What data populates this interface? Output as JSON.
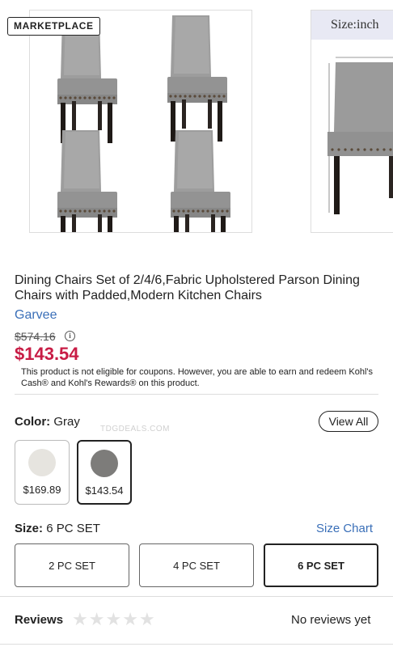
{
  "gallery": {
    "badge": "MARKETPLACE",
    "next_slide_title": "Size:inch",
    "slide_count": 5,
    "active_slide": 1
  },
  "product": {
    "title": "Dining Chairs Set of 2/4/6,Fabric Upholstered Parson Dining Chairs with Padded,Modern Kitchen Chairs",
    "brand": "Garvee",
    "original_price": "$574.16",
    "sale_price": "$143.54",
    "coupon_note": "This product is not eligible for coupons. However, you are able to earn and redeem Kohl's Cash® and Kohl's Rewards® on this product."
  },
  "color": {
    "label": "Color:",
    "value": "Gray",
    "view_all": "View All",
    "watermark": "TDGDEALS.COM",
    "swatches": [
      {
        "price": "$169.89",
        "color": "#e6e4df",
        "selected": false
      },
      {
        "price": "$143.54",
        "color": "#7d7c7a",
        "selected": true
      }
    ]
  },
  "size": {
    "label": "Size:",
    "value": "6 PC SET",
    "chart_link": "Size Chart",
    "options": [
      "2 PC SET",
      "4 PC SET",
      "6 PC SET"
    ],
    "selected": "6 PC SET"
  },
  "reviews": {
    "label": "Reviews",
    "rating": 0,
    "max_rating": 5,
    "status": "No reviews yet"
  },
  "colors": {
    "sale": "#c81c45",
    "link": "#3a6fb8"
  }
}
